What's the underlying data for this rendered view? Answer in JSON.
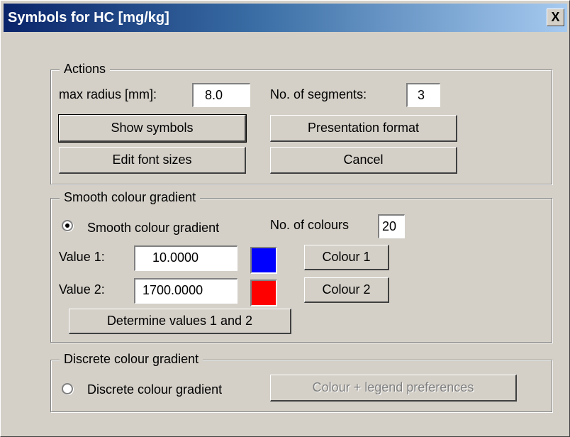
{
  "window": {
    "title": "Symbols for HC [mg/kg]",
    "close_label": "X"
  },
  "actions": {
    "legend": "Actions",
    "max_radius_label": "max radius [mm]:",
    "max_radius_value": "8.0",
    "segments_label": "No. of segments:",
    "segments_value": "3",
    "show_symbols": "Show symbols",
    "presentation_format": "Presentation format",
    "edit_font_sizes": "Edit font sizes",
    "cancel": "Cancel"
  },
  "smooth": {
    "legend": "Smooth colour gradient",
    "radio_label": "Smooth colour gradient",
    "radio_checked": true,
    "num_colours_label": "No. of colours",
    "num_colours_value": "20",
    "value1_label": "Value 1:",
    "value1": "10.0000",
    "value2_label": "Value 2:",
    "value2": "1700.0000",
    "colour1_label": "Colour 1",
    "colour2_label": "Colour 2",
    "colour1": "#0000ff",
    "colour2": "#ff0000",
    "determine_label": "Determine values 1 and 2"
  },
  "discrete": {
    "legend": "Discrete colour gradient",
    "radio_label": "Discrete colour gradient",
    "radio_checked": false,
    "preferences_label": "Colour + legend preferences"
  }
}
